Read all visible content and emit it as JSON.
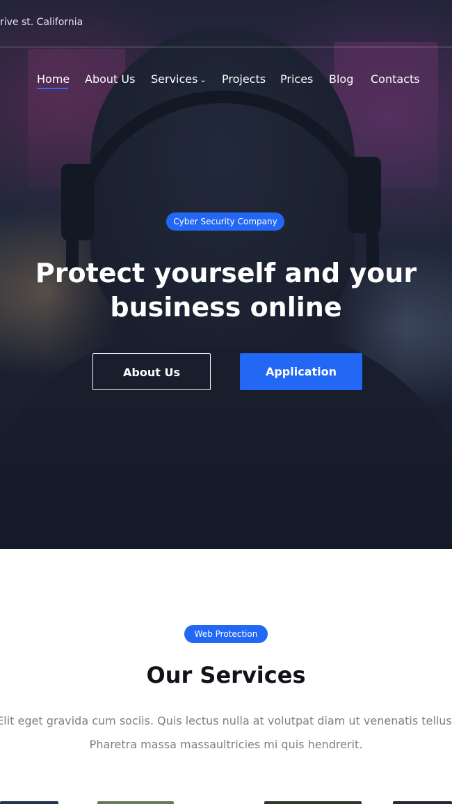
{
  "header": {
    "address": "rive st. California"
  },
  "nav": {
    "items": [
      "Home",
      "About Us",
      "Services",
      "Projects",
      "Prices",
      "Blog",
      "Contacts"
    ],
    "active": "Home"
  },
  "hero": {
    "badge": "Cyber Security Company",
    "title_line1": "Protect yourself and your",
    "title_line2": "business online",
    "button_about": "About Us",
    "button_application": "Application"
  },
  "services": {
    "badge": "Web Protection",
    "title": "Our Services",
    "text_line1": "Elit eget gravida cum sociis. Quis lectus nulla at volutpat diam ut venenatis tellus.",
    "text_line2": "Pharetra massa massaultricies mi quis hendrerit."
  },
  "colors": {
    "accent": "#2368f5",
    "hero_overlay": "#1b2030",
    "body_text": "#7b7f88",
    "heading": "#111318"
  }
}
